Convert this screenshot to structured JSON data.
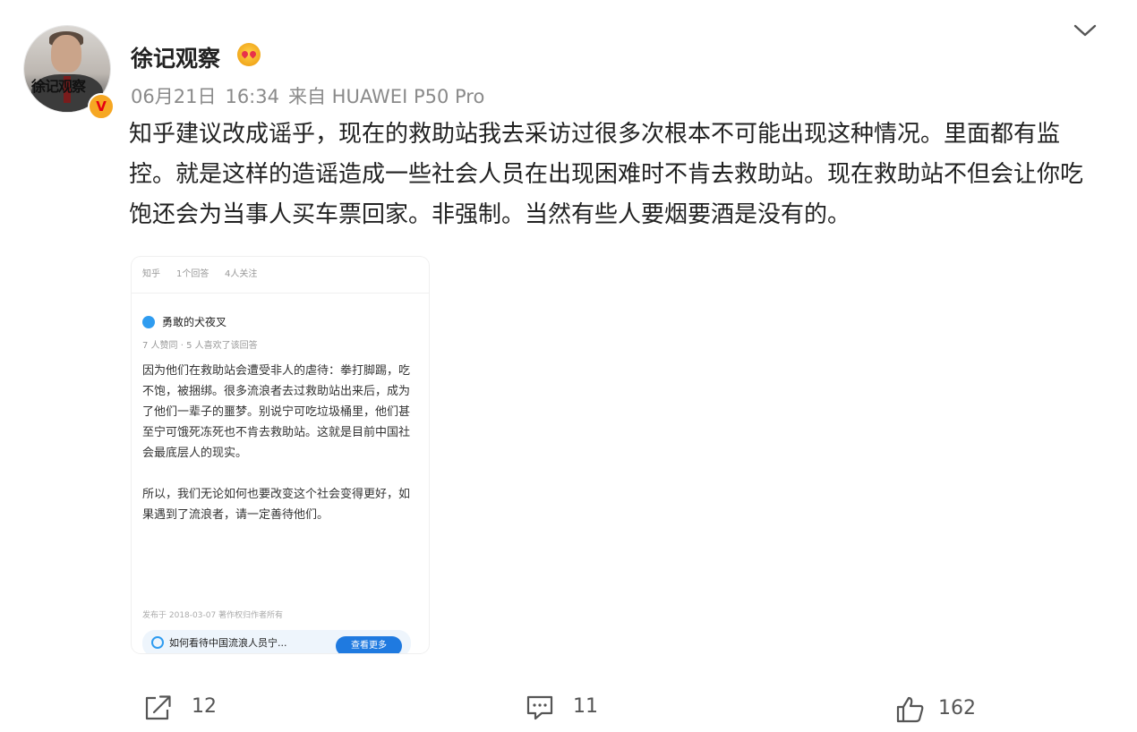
{
  "post": {
    "username": "徐记观察",
    "avatar_text": "徐记观察",
    "verified_badge": "V",
    "date": "06月21日",
    "time": "16:34",
    "source": "来自 HUAWEI P50 Pro",
    "text": "知乎建议改成谣乎，现在的救助站我去采访过很多次根本不可能出现这种情况。里面都有监控。就是这样的造谣造成一些社会人员在出现困难时不肯去救助站。现在救助站不但会让你吃饱还会为当事人买车票回家。非强制。当然有些人要烟要酒是没有的。"
  },
  "embedded_card": {
    "topbar": [
      "知乎",
      "1个回答",
      "4人关注"
    ],
    "author_name": "勇敢的犬夜叉",
    "stats": "7 人赞同 · 5 人喜欢了该回答",
    "answer_paragraphs": [
      "因为他们在救助站会遭受非人的虐待：拳打脚踢，吃不饱，被捆绑。很多流浪者去过救助站出来后，成为了他们一辈子的噩梦。别说宁可吃垃圾桶里，他们甚至宁可饿死冻死也不肯去救助站。这就是目前中国社会最底层人的现实。",
      "所以，我们无论如何也要改变这个社会变得更好，如果遇到了流浪者，请一定善待他们。"
    ],
    "footer": "发布于 2018-03-07    著作权归作者所有",
    "search_text": "如何看待中国流浪人员宁...",
    "search_button": "查看更多"
  },
  "actions": {
    "share_count": "12",
    "comment_count": "11",
    "like_count": "162"
  },
  "icons": {
    "expand": "chevron-down-icon",
    "share": "share-icon",
    "comment": "comment-icon",
    "like": "thumbs-up-icon"
  },
  "colors": {
    "username": "#222222",
    "meta": "#8a8a8a",
    "verified": "#f6a723",
    "zhihu_blue": "#1f7ae0"
  }
}
